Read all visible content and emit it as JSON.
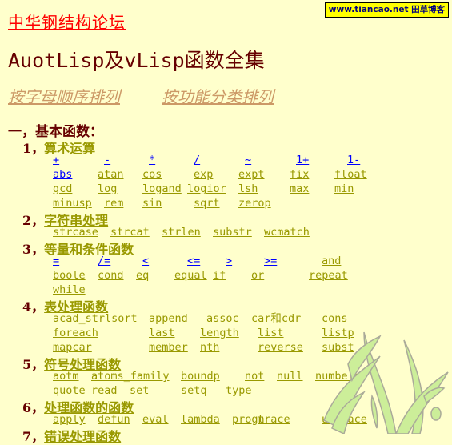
{
  "header": {
    "site_link": "中华钢结构论坛",
    "badge": "www.tiancao.net 田草博客",
    "title": "AuotLisp及vLisp函数全集",
    "sort_links": [
      "按字母顺序排列",
      "按功能分类排列"
    ]
  },
  "part1": {
    "heading": "一，基本函数：",
    "sections": [
      {
        "num": "1，",
        "title": "算术运算",
        "rows": [
          [
            {
              "t": "+",
              "blue": true
            },
            {
              "t": "-",
              "blue": true
            },
            {
              "t": "*",
              "blue": true
            },
            {
              "t": "/",
              "blue": true
            },
            {
              "t": "~",
              "blue": true
            },
            {
              "t": "1+",
              "blue": true
            },
            {
              "t": "1-",
              "blue": true
            }
          ],
          [
            {
              "t": "abs",
              "blue": true
            },
            {
              "t": "atan"
            },
            {
              "t": "cos"
            },
            {
              "t": "exp"
            },
            {
              "t": "expt"
            },
            {
              "t": "fix"
            },
            {
              "t": "float"
            }
          ],
          [
            {
              "t": "gcd"
            },
            {
              "t": "log"
            },
            {
              "t": "logand"
            },
            {
              "t": "logior"
            },
            {
              "t": "lsh"
            },
            {
              "t": "max"
            },
            {
              "t": "min"
            }
          ],
          [
            {
              "t": "minusp"
            },
            {
              "t": "rem"
            },
            {
              "t": "sin"
            },
            {
              "t": "sqrt"
            },
            {
              "t": "zerop"
            }
          ]
        ]
      },
      {
        "num": "2，",
        "title": "字符串处理",
        "rows": [
          [
            {
              "t": "strcase"
            },
            {
              "t": "strcat"
            },
            {
              "t": "strlen"
            },
            {
              "t": "substr"
            },
            {
              "t": "wcmatch"
            }
          ]
        ]
      },
      {
        "num": "3，",
        "title": "等量和条件函数",
        "rows": [
          [
            {
              "t": "=",
              "blue": true
            },
            {
              "t": "/=",
              "blue": true
            },
            {
              "t": "<",
              "blue": true
            },
            {
              "t": "<=",
              "blue": true
            },
            {
              "t": ">",
              "blue": true
            },
            {
              "t": ">=",
              "blue": true
            },
            {
              "t": "and"
            }
          ],
          [
            {
              "t": "boole"
            },
            {
              "t": "cond"
            },
            {
              "t": "eq"
            },
            {
              "t": "equal"
            },
            {
              "t": "if"
            },
            {
              "t": "or"
            },
            {
              "t": "repeat"
            }
          ],
          [
            {
              "t": "while"
            }
          ]
        ]
      },
      {
        "num": "4，",
        "title": "表处理函数",
        "rows": [
          [
            {
              "t": "acad_strlsort"
            },
            {
              "t": "append"
            },
            {
              "t": "assoc"
            },
            {
              "t": "car和cdr"
            },
            {
              "t": "cons"
            }
          ],
          [
            {
              "t": "foreach"
            },
            {
              "t": "last"
            },
            {
              "t": "length"
            },
            {
              "t": "list"
            },
            {
              "t": "listp"
            }
          ],
          [
            {
              "t": "mapcar"
            },
            {
              "t": "member"
            },
            {
              "t": "nth"
            },
            {
              "t": "reverse"
            },
            {
              "t": "subst"
            }
          ]
        ]
      },
      {
        "num": "5，",
        "title": "符号处理函数",
        "rows": [
          [
            {
              "t": "aotm"
            },
            {
              "t": "atoms_family"
            },
            {
              "t": "boundp"
            },
            {
              "t": "not"
            },
            {
              "t": "null"
            },
            {
              "t": "numberp"
            }
          ],
          [
            {
              "t": "quote"
            },
            {
              "t": "read"
            },
            {
              "t": "set"
            },
            {
              "t": "setq"
            },
            {
              "t": "type"
            }
          ]
        ]
      },
      {
        "num": "6，",
        "title": "处理函数的函数",
        "rows": [
          [
            {
              "t": "apply"
            },
            {
              "t": "defun"
            },
            {
              "t": "eval"
            },
            {
              "t": "lambda"
            },
            {
              "t": "progn"
            },
            {
              "t": "trace"
            },
            {
              "t": "untrace"
            }
          ]
        ]
      },
      {
        "num": "7，",
        "title": "错误处理函数",
        "rows": []
      }
    ]
  }
}
